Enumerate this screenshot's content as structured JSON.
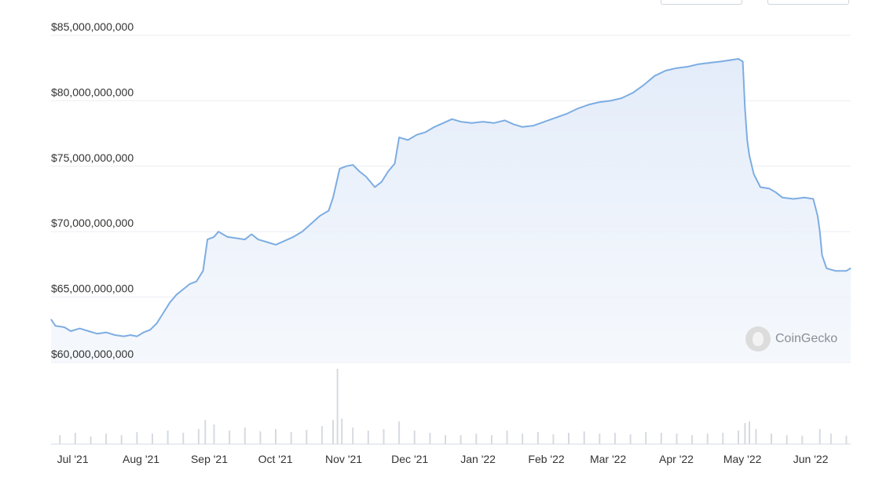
{
  "watermark": {
    "text": "CoinGecko",
    "icon": "coingecko-gecko-icon"
  },
  "chart_data": {
    "type": "area",
    "title": "",
    "xlabel": "",
    "ylabel": "",
    "ylim": [
      60000000000,
      85000000000
    ],
    "grid": true,
    "line_color": "#7dade2",
    "fill_color": "#eef3fb",
    "y_ticks": [
      {
        "value": 85000000000,
        "label": "$85,000,000,000"
      },
      {
        "value": 80000000000,
        "label": "$80,000,000,000"
      },
      {
        "value": 75000000000,
        "label": "$75,000,000,000"
      },
      {
        "value": 70000000000,
        "label": "$70,000,000,000"
      },
      {
        "value": 65000000000,
        "label": "$65,000,000,000"
      },
      {
        "value": 60000000000,
        "label": "$60,000,000,000"
      }
    ],
    "x_ticks": [
      {
        "date": "2021-07-01",
        "label": "Jul '21"
      },
      {
        "date": "2021-08-01",
        "label": "Aug '21"
      },
      {
        "date": "2021-09-01",
        "label": "Sep '21"
      },
      {
        "date": "2021-10-01",
        "label": "Oct '21"
      },
      {
        "date": "2021-11-01",
        "label": "Nov '21"
      },
      {
        "date": "2021-12-01",
        "label": "Dec '21"
      },
      {
        "date": "2022-01-01",
        "label": "Jan '22"
      },
      {
        "date": "2022-02-01",
        "label": "Feb '22"
      },
      {
        "date": "2022-03-01",
        "label": "Mar '22"
      },
      {
        "date": "2022-04-01",
        "label": "Apr '22"
      },
      {
        "date": "2022-05-01",
        "label": "May '22"
      },
      {
        "date": "2022-06-01",
        "label": "Jun '22"
      }
    ],
    "series": [
      {
        "points": [
          [
            "2021-06-29",
            63.3
          ],
          [
            "2021-07-01",
            62.8
          ],
          [
            "2021-07-05",
            62.7
          ],
          [
            "2021-07-08",
            62.4
          ],
          [
            "2021-07-12",
            62.6
          ],
          [
            "2021-07-16",
            62.4
          ],
          [
            "2021-07-20",
            62.2
          ],
          [
            "2021-07-24",
            62.3
          ],
          [
            "2021-07-28",
            62.1
          ],
          [
            "2021-08-01",
            62.0
          ],
          [
            "2021-08-04",
            62.1
          ],
          [
            "2021-08-07",
            62.0
          ],
          [
            "2021-08-10",
            62.3
          ],
          [
            "2021-08-13",
            62.5
          ],
          [
            "2021-08-16",
            63.0
          ],
          [
            "2021-08-19",
            63.8
          ],
          [
            "2021-08-22",
            64.6
          ],
          [
            "2021-08-25",
            65.2
          ],
          [
            "2021-08-28",
            65.6
          ],
          [
            "2021-08-31",
            66.0
          ],
          [
            "2021-09-03",
            66.2
          ],
          [
            "2021-09-06",
            67.0
          ],
          [
            "2021-09-08",
            69.4
          ],
          [
            "2021-09-11",
            69.6
          ],
          [
            "2021-09-13",
            70.0
          ],
          [
            "2021-09-17",
            69.6
          ],
          [
            "2021-09-21",
            69.5
          ],
          [
            "2021-09-25",
            69.4
          ],
          [
            "2021-09-28",
            69.8
          ],
          [
            "2021-10-01",
            69.4
          ],
          [
            "2021-10-05",
            69.2
          ],
          [
            "2021-10-09",
            69.0
          ],
          [
            "2021-10-13",
            69.3
          ],
          [
            "2021-10-17",
            69.6
          ],
          [
            "2021-10-21",
            70.0
          ],
          [
            "2021-10-25",
            70.6
          ],
          [
            "2021-10-29",
            71.2
          ],
          [
            "2021-11-02",
            71.6
          ],
          [
            "2021-11-04",
            72.6
          ],
          [
            "2021-11-07",
            74.8
          ],
          [
            "2021-11-10",
            75.0
          ],
          [
            "2021-11-13",
            75.1
          ],
          [
            "2021-11-16",
            74.6
          ],
          [
            "2021-11-19",
            74.2
          ],
          [
            "2021-11-23",
            73.4
          ],
          [
            "2021-11-26",
            73.8
          ],
          [
            "2021-11-29",
            74.6
          ],
          [
            "2021-12-02",
            75.2
          ],
          [
            "2021-12-04",
            77.2
          ],
          [
            "2021-12-08",
            77.0
          ],
          [
            "2021-12-12",
            77.4
          ],
          [
            "2021-12-16",
            77.6
          ],
          [
            "2021-12-20",
            78.0
          ],
          [
            "2021-12-24",
            78.3
          ],
          [
            "2021-12-28",
            78.6
          ],
          [
            "2022-01-01",
            78.4
          ],
          [
            "2022-01-06",
            78.3
          ],
          [
            "2022-01-11",
            78.4
          ],
          [
            "2022-01-16",
            78.3
          ],
          [
            "2022-01-21",
            78.5
          ],
          [
            "2022-01-25",
            78.2
          ],
          [
            "2022-01-29",
            78.0
          ],
          [
            "2022-02-03",
            78.1
          ],
          [
            "2022-02-08",
            78.4
          ],
          [
            "2022-02-13",
            78.7
          ],
          [
            "2022-02-18",
            79.0
          ],
          [
            "2022-02-23",
            79.4
          ],
          [
            "2022-02-28",
            79.7
          ],
          [
            "2022-03-05",
            79.9
          ],
          [
            "2022-03-10",
            80.0
          ],
          [
            "2022-03-15",
            80.2
          ],
          [
            "2022-03-20",
            80.6
          ],
          [
            "2022-03-25",
            81.2
          ],
          [
            "2022-03-30",
            81.9
          ],
          [
            "2022-04-04",
            82.3
          ],
          [
            "2022-04-09",
            82.5
          ],
          [
            "2022-04-14",
            82.6
          ],
          [
            "2022-04-19",
            82.8
          ],
          [
            "2022-04-24",
            82.9
          ],
          [
            "2022-04-29",
            83.0
          ],
          [
            "2022-05-03",
            83.1
          ],
          [
            "2022-05-07",
            83.2
          ],
          [
            "2022-05-09",
            83.0
          ],
          [
            "2022-05-10",
            79.4
          ],
          [
            "2022-05-11",
            77.0
          ],
          [
            "2022-05-12",
            75.8
          ],
          [
            "2022-05-14",
            74.4
          ],
          [
            "2022-05-17",
            73.4
          ],
          [
            "2022-05-21",
            73.3
          ],
          [
            "2022-05-24",
            73.0
          ],
          [
            "2022-05-27",
            72.6
          ],
          [
            "2022-06-01",
            72.5
          ],
          [
            "2022-06-06",
            72.6
          ],
          [
            "2022-06-10",
            72.5
          ],
          [
            "2022-06-12",
            71.2
          ],
          [
            "2022-06-13",
            70.0
          ],
          [
            "2022-06-14",
            68.2
          ],
          [
            "2022-06-16",
            67.2
          ],
          [
            "2022-06-20",
            67.0
          ],
          [
            "2022-06-25",
            67.0
          ],
          [
            "2022-06-27",
            67.2
          ]
        ]
      }
    ],
    "volume_bars": {
      "color": "#d6dae0",
      "points": [
        [
          "2021-07-03",
          0.12
        ],
        [
          "2021-07-10",
          0.15
        ],
        [
          "2021-07-17",
          0.1
        ],
        [
          "2021-07-24",
          0.14
        ],
        [
          "2021-07-31",
          0.12
        ],
        [
          "2021-08-07",
          0.16
        ],
        [
          "2021-08-14",
          0.14
        ],
        [
          "2021-08-21",
          0.18
        ],
        [
          "2021-08-28",
          0.15
        ],
        [
          "2021-09-04",
          0.2
        ],
        [
          "2021-09-07",
          0.32
        ],
        [
          "2021-09-11",
          0.26
        ],
        [
          "2021-09-18",
          0.18
        ],
        [
          "2021-09-25",
          0.22
        ],
        [
          "2021-10-02",
          0.17
        ],
        [
          "2021-10-09",
          0.2
        ],
        [
          "2021-10-16",
          0.16
        ],
        [
          "2021-10-23",
          0.19
        ],
        [
          "2021-10-30",
          0.24
        ],
        [
          "2021-11-04",
          0.32
        ],
        [
          "2021-11-06",
          1.0
        ],
        [
          "2021-11-08",
          0.34
        ],
        [
          "2021-11-13",
          0.22
        ],
        [
          "2021-11-20",
          0.18
        ],
        [
          "2021-11-27",
          0.2
        ],
        [
          "2021-12-04",
          0.3
        ],
        [
          "2021-12-11",
          0.18
        ],
        [
          "2021-12-18",
          0.15
        ],
        [
          "2021-12-25",
          0.12
        ],
        [
          "2022-01-01",
          0.12
        ],
        [
          "2022-01-08",
          0.14
        ],
        [
          "2022-01-15",
          0.12
        ],
        [
          "2022-01-22",
          0.18
        ],
        [
          "2022-01-29",
          0.14
        ],
        [
          "2022-02-05",
          0.16
        ],
        [
          "2022-02-12",
          0.13
        ],
        [
          "2022-02-19",
          0.15
        ],
        [
          "2022-02-26",
          0.17
        ],
        [
          "2022-03-05",
          0.14
        ],
        [
          "2022-03-12",
          0.15
        ],
        [
          "2022-03-19",
          0.13
        ],
        [
          "2022-03-26",
          0.16
        ],
        [
          "2022-04-02",
          0.15
        ],
        [
          "2022-04-09",
          0.14
        ],
        [
          "2022-04-16",
          0.12
        ],
        [
          "2022-04-23",
          0.14
        ],
        [
          "2022-04-30",
          0.15
        ],
        [
          "2022-05-07",
          0.18
        ],
        [
          "2022-05-10",
          0.28
        ],
        [
          "2022-05-12",
          0.3
        ],
        [
          "2022-05-15",
          0.2
        ],
        [
          "2022-05-22",
          0.14
        ],
        [
          "2022-05-29",
          0.12
        ],
        [
          "2022-06-05",
          0.11
        ],
        [
          "2022-06-13",
          0.2
        ],
        [
          "2022-06-18",
          0.14
        ],
        [
          "2022-06-25",
          0.11
        ]
      ]
    }
  }
}
